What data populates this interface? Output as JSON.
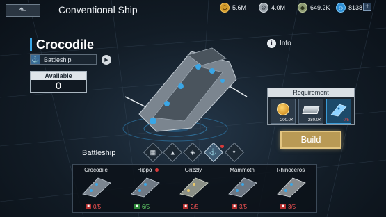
{
  "header": {
    "title": "Conventional Ship",
    "back_icon": "back-arrow-icon",
    "resources": [
      {
        "icon": "gold-coin-icon",
        "value": "5.6M"
      },
      {
        "icon": "metal-icon",
        "value": "4.0M"
      },
      {
        "icon": "crystal-icon",
        "value": "649.2K"
      },
      {
        "icon": "gem-icon",
        "value": "8138"
      }
    ],
    "add_label": "+"
  },
  "ship": {
    "name": "Crocodile",
    "class_label": "Battleship",
    "available_label": "Available",
    "available_value": "0"
  },
  "info": {
    "label": "Info"
  },
  "requirement": {
    "title": "Requirement",
    "items": [
      {
        "icon": "gold-coin-icon",
        "qty": "200.0K"
      },
      {
        "icon": "metal-ingot-icon",
        "qty": "280.0K"
      },
      {
        "icon": "blueprint-ship-icon",
        "qty": "0/5"
      }
    ]
  },
  "build_label": "Build",
  "category": {
    "title": "Battleship",
    "tabs": [
      "frigate-tab-icon",
      "destroyer-tab-icon",
      "cruiser-tab-icon",
      "battleship-tab-icon",
      "carrier-tab-icon"
    ],
    "active_tab": 3
  },
  "ships": [
    {
      "name": "Crocodile",
      "count": "0/5",
      "status": "red"
    },
    {
      "name": "Hippo",
      "count": "6/5",
      "status": "green"
    },
    {
      "name": "Grizzly",
      "count": "2/5",
      "status": "red"
    },
    {
      "name": "Mammoth",
      "count": "3/5",
      "status": "red"
    },
    {
      "name": "Rhinoceros",
      "count": "3/5",
      "status": "red"
    }
  ],
  "colors": {
    "accent": "#3aa6e6",
    "build": "#b99a55",
    "alert_red": "#d93a3a",
    "ok_green": "#63d36a"
  }
}
